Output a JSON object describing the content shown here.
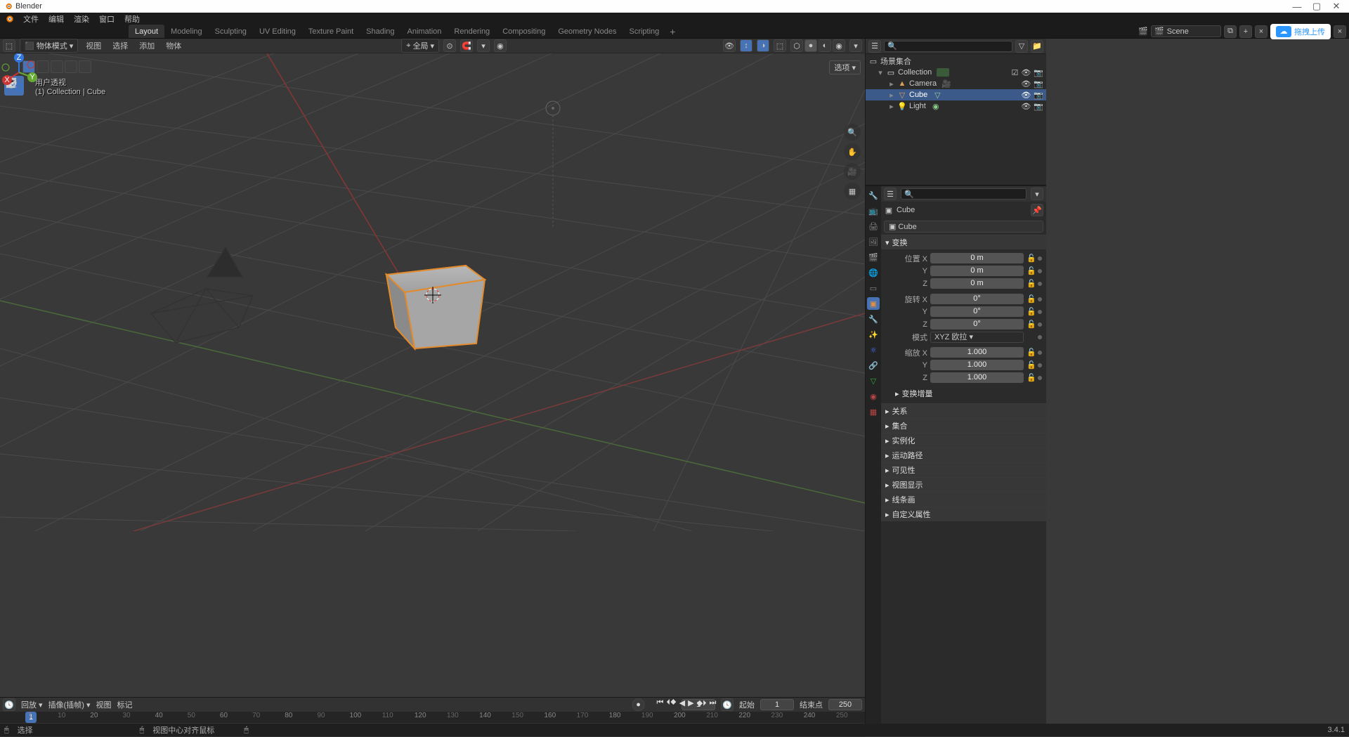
{
  "window": {
    "title": "Blender",
    "version": "3.4.1"
  },
  "menubar": [
    "文件",
    "编辑",
    "渲染",
    "窗口",
    "帮助"
  ],
  "workspaces": {
    "items": [
      "Layout",
      "Modeling",
      "Sculpting",
      "UV Editing",
      "Texture Paint",
      "Shading",
      "Animation",
      "Rendering",
      "Compositing",
      "Geometry Nodes",
      "Scripting"
    ],
    "active": "Layout"
  },
  "scene": {
    "label": "Scene",
    "upload_label": "拖拽上传"
  },
  "view3d": {
    "mode": "物体模式",
    "menus": [
      "视图",
      "选择",
      "添加",
      "物体"
    ],
    "global_label": "全局",
    "overlay_line1": "用户透视",
    "overlay_line2": "(1) Collection | Cube",
    "options_label": "选项"
  },
  "outliner": {
    "title": "场景集合",
    "items": [
      {
        "label": "Collection",
        "icon": "collection",
        "depth": 0,
        "children": true,
        "active": false
      },
      {
        "label": "Camera",
        "icon": "camera",
        "depth": 1,
        "children": true,
        "active": false
      },
      {
        "label": "Cube",
        "icon": "mesh",
        "depth": 1,
        "children": true,
        "active": true
      },
      {
        "label": "Light",
        "icon": "light",
        "depth": 1,
        "children": true,
        "active": false
      }
    ]
  },
  "properties": {
    "breadcrumb": "Cube",
    "data_name": "Cube",
    "transform": {
      "title": "变换",
      "location": {
        "label": "位置",
        "x": "0 m",
        "y": "0 m",
        "z": "0 m"
      },
      "rotation": {
        "label": "旋转",
        "x": "0°",
        "y": "0°",
        "z": "0°"
      },
      "mode": {
        "label": "模式",
        "value": "XYZ 欧拉"
      },
      "scale": {
        "label": "缩放",
        "x": "1.000",
        "y": "1.000",
        "z": "1.000"
      },
      "delta": "变换增量"
    },
    "panels": [
      "关系",
      "集合",
      "实例化",
      "运动路径",
      "可见性",
      "视图显示",
      "线条画",
      "自定义属性"
    ]
  },
  "timeline": {
    "playback": "回放",
    "keying": "插像(插帧)",
    "menus": [
      "视图",
      "标记"
    ],
    "current": 1,
    "start_label": "起始",
    "start": 1,
    "end_label": "结束点",
    "end": 250,
    "marks": [
      1,
      20,
      40,
      60,
      80,
      100,
      120,
      140,
      160,
      180,
      200,
      220,
      240
    ],
    "mark_minor": [
      10,
      30,
      50,
      70,
      90,
      110,
      130,
      150,
      170,
      190,
      210,
      230,
      250
    ]
  },
  "status": {
    "left": "选择",
    "mid": "视图中心对齐鼠标"
  }
}
